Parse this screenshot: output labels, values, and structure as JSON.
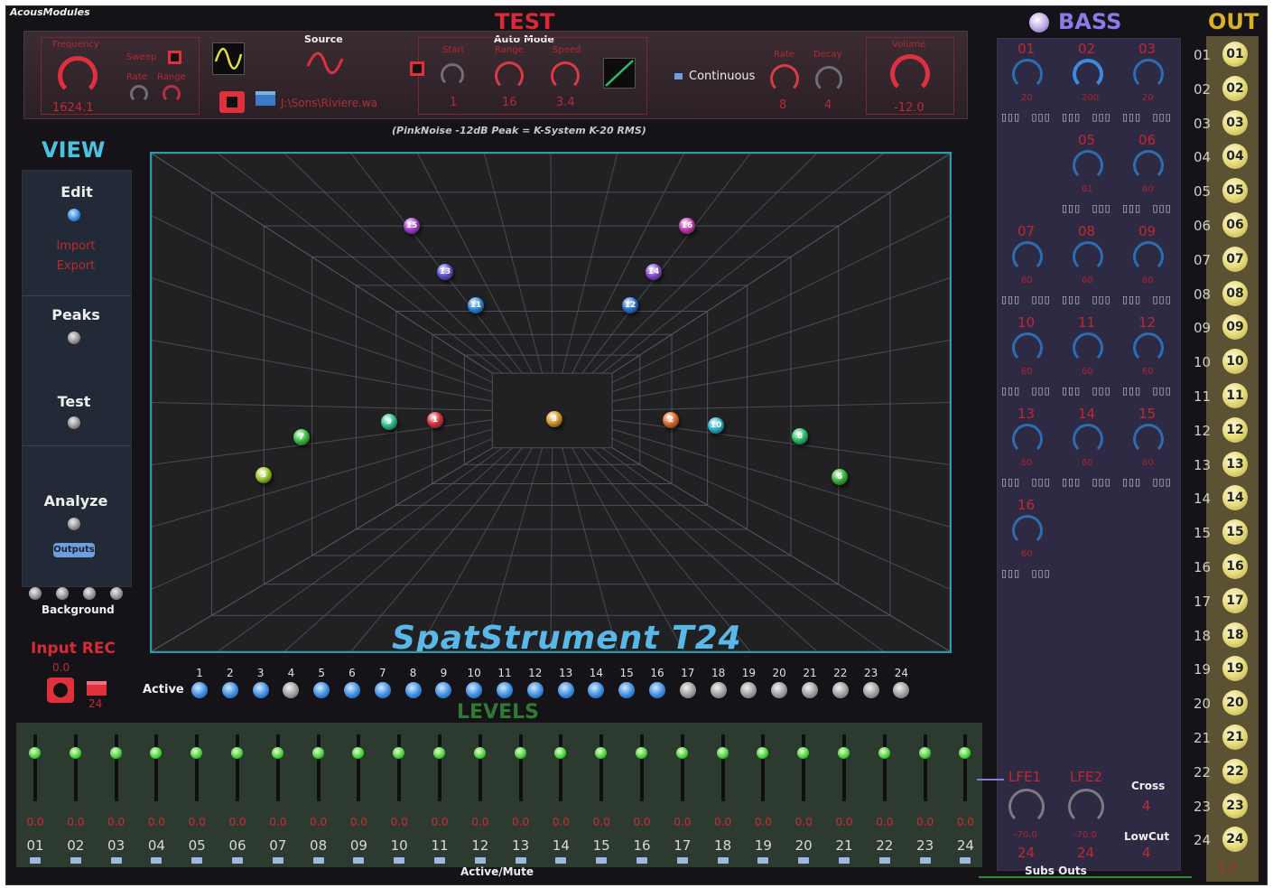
{
  "app": {
    "name": "AcousModules"
  },
  "test": {
    "title": "TEST",
    "frequency_label": "Frequency",
    "frequency_value": "1624.1",
    "sweep_label": "Sweep",
    "rate_label": "Rate",
    "range_label": "Range",
    "source_label": "Source",
    "file_path": "J:\\Sons\\Riviere.wa",
    "auto_mode_label": "Auto Mode",
    "start_label": "Start",
    "start_value": "1",
    "auto_range_label": "Range",
    "auto_range_value": "16",
    "speed_label": "Speed",
    "speed_value": "3.4",
    "continuous_label": "Continuous",
    "decay_rate_label": "Rate",
    "decay_rate_value": "8",
    "decay_label": "Decay",
    "decay_value": "4",
    "volume_label": "Volume",
    "volume_value": "-12.0",
    "note": "(PinkNoise -12dB Peak = K-System K-20 RMS)"
  },
  "view": {
    "title": "VIEW",
    "edit_label": "Edit",
    "import_label": "Import",
    "export_label": "Export",
    "peaks_label": "Peaks",
    "test_label": "Test",
    "analyze_label": "Analyze",
    "outputs_label": "Outputs",
    "background_label": "Background"
  },
  "input_rec": {
    "title": "Input REC",
    "value": "0.0",
    "count": "24"
  },
  "stage": {
    "product_name": "SpatStrument T24",
    "speakers": [
      {
        "n": "1",
        "color": "#d8343e"
      },
      {
        "n": "2",
        "color": "#e06a2a"
      },
      {
        "n": "3",
        "color": "#d69a2a"
      },
      {
        "n": "4",
        "color": "#c9b03a"
      },
      {
        "n": "5",
        "color": "#9acb2a"
      },
      {
        "n": "6",
        "color": "#38b83a"
      },
      {
        "n": "7",
        "color": "#3ac03e"
      },
      {
        "n": "8",
        "color": "#2cc06a"
      },
      {
        "n": "9",
        "color": "#2ac08e"
      },
      {
        "n": "10",
        "color": "#28b2c8"
      },
      {
        "n": "11",
        "color": "#2a8ae0"
      },
      {
        "n": "12",
        "color": "#2a72d8"
      },
      {
        "n": "13",
        "color": "#5a52d8"
      },
      {
        "n": "14",
        "color": "#8a4ad8"
      },
      {
        "n": "15",
        "color": "#a43ed0"
      },
      {
        "n": "16",
        "color": "#c83ab0"
      }
    ]
  },
  "active": {
    "label": "Active",
    "channels": [
      "1",
      "2",
      "3",
      "4",
      "5",
      "6",
      "7",
      "8",
      "9",
      "10",
      "11",
      "12",
      "13",
      "14",
      "15",
      "16",
      "17",
      "18",
      "19",
      "20",
      "21",
      "22",
      "23",
      "24"
    ],
    "state": [
      1,
      1,
      1,
      0,
      1,
      1,
      1,
      1,
      1,
      1,
      1,
      1,
      1,
      1,
      1,
      1,
      0,
      0,
      0,
      0,
      0,
      0,
      0,
      0
    ]
  },
  "levels": {
    "title": "LEVELS",
    "values": [
      "0.0",
      "0.0",
      "0.0",
      "0.0",
      "0.0",
      "0.0",
      "0.0",
      "0.0",
      "0.0",
      "0.0",
      "0.0",
      "0.0",
      "0.0",
      "0.0",
      "0.0",
      "0.0",
      "0.0",
      "0.0",
      "0.0",
      "0.0",
      "0.0",
      "0.0",
      "0.0",
      "0.0"
    ],
    "channels": [
      "01",
      "02",
      "03",
      "04",
      "05",
      "06",
      "07",
      "08",
      "09",
      "10",
      "11",
      "12",
      "13",
      "14",
      "15",
      "16",
      "17",
      "18",
      "19",
      "20",
      "21",
      "22",
      "23",
      "24"
    ],
    "footer": "Active/Mute"
  },
  "bass": {
    "title": "BASS",
    "channels": [
      {
        "n": "01",
        "v": "20"
      },
      {
        "n": "02",
        "v": "200"
      },
      {
        "n": "03",
        "v": "20"
      },
      {
        "n": "05",
        "v": "61"
      },
      {
        "n": "06",
        "v": "60"
      },
      {
        "n": "07",
        "v": "60"
      },
      {
        "n": "08",
        "v": "60"
      },
      {
        "n": "09",
        "v": "60"
      },
      {
        "n": "10",
        "v": "60"
      },
      {
        "n": "11",
        "v": "60"
      },
      {
        "n": "12",
        "v": "60"
      },
      {
        "n": "13",
        "v": "60"
      },
      {
        "n": "14",
        "v": "60"
      },
      {
        "n": "15",
        "v": "60"
      },
      {
        "n": "16",
        "v": "60"
      }
    ],
    "tri_glyph": "▯▯▯",
    "lfe1_label": "LFE1",
    "lfe2_label": "LFE2",
    "lfe1_value": "-70.0",
    "lfe2_value": "-70.0",
    "lfe1_count": "24",
    "lfe2_count": "24",
    "cross_label": "Cross",
    "cross_value": "4",
    "lowcut_label": "LowCut",
    "lowcut_value": "4",
    "subs_outs_label": "Subs Outs",
    "sub_marks": "1  2"
  },
  "out": {
    "title": "OUT",
    "rows": [
      "01",
      "02",
      "03",
      "04",
      "05",
      "06",
      "07",
      "08",
      "09",
      "10",
      "11",
      "12",
      "13",
      "14",
      "15",
      "16",
      "17",
      "18",
      "19",
      "20",
      "21",
      "22",
      "23",
      "24"
    ]
  }
}
